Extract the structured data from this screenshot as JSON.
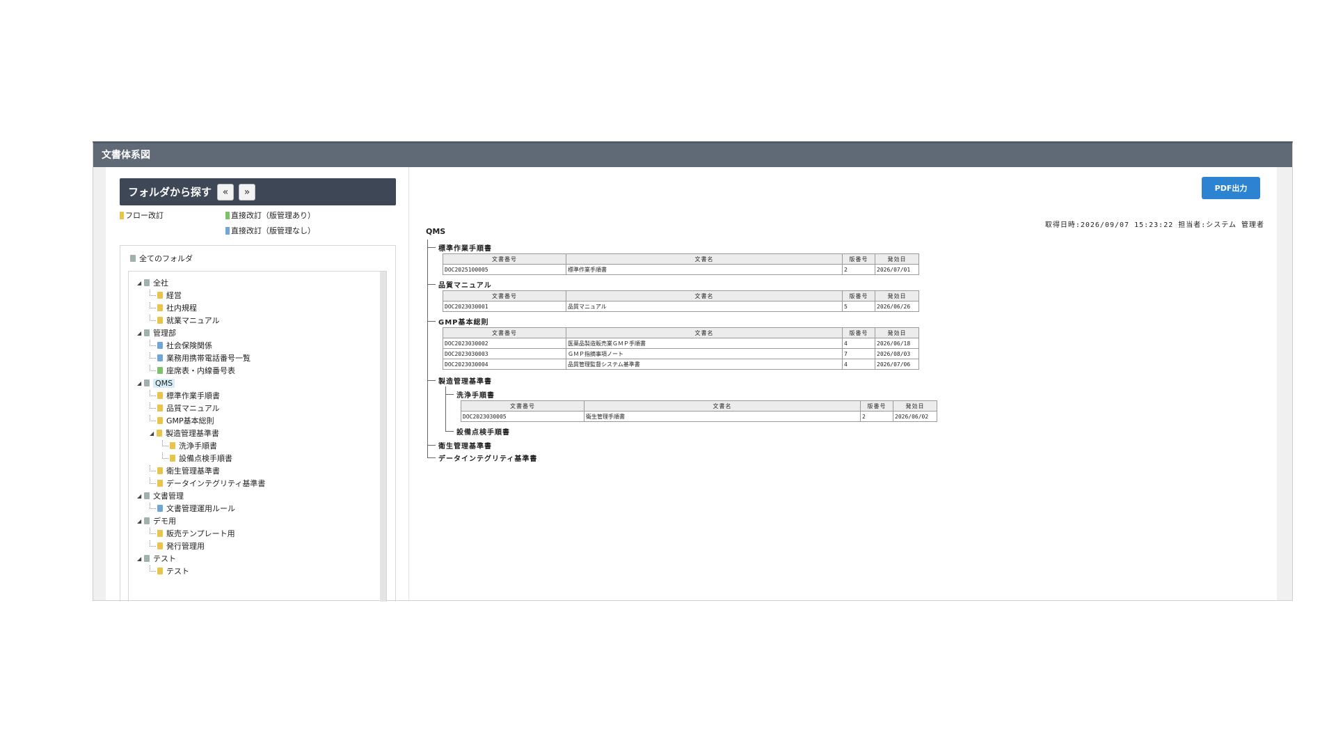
{
  "panel": {
    "title": "文書体系図"
  },
  "folder_search": {
    "title": "フォルダから探す",
    "prev_label": "«",
    "next_label": "»"
  },
  "legend": {
    "flow": "フロー改訂",
    "direct_versioned": "直接改訂（版管理あり）",
    "direct_unversioned": "直接改訂（版管理なし）"
  },
  "tree": {
    "root": "全てのフォルダ",
    "nodes": [
      {
        "label": "全社",
        "level": 0,
        "toggle": "◢",
        "icon": "gray"
      },
      {
        "label": "経営",
        "level": 1,
        "icon": "yellow"
      },
      {
        "label": "社内規程",
        "level": 1,
        "icon": "yellow"
      },
      {
        "label": "就業マニュアル",
        "level": 1,
        "icon": "yellow"
      },
      {
        "label": "管理部",
        "level": 0,
        "toggle": "◢",
        "icon": "gray"
      },
      {
        "label": "社会保険関係",
        "level": 1,
        "icon": "blue"
      },
      {
        "label": "業務用携帯電話番号一覧",
        "level": 1,
        "icon": "blue"
      },
      {
        "label": "座席表・内線番号表",
        "level": 1,
        "icon": "green"
      },
      {
        "label": "QMS",
        "level": 0,
        "toggle": "◢",
        "icon": "gray",
        "selected": true
      },
      {
        "label": "標準作業手順書",
        "level": 1,
        "icon": "yellow"
      },
      {
        "label": "品質マニュアル",
        "level": 1,
        "icon": "yellow"
      },
      {
        "label": "GMP基本総則",
        "level": 1,
        "icon": "yellow"
      },
      {
        "label": "製造管理基準書",
        "level": 1,
        "toggle": "◢",
        "icon": "yellow"
      },
      {
        "label": "洗浄手順書",
        "level": 2,
        "icon": "yellow"
      },
      {
        "label": "設備点検手順書",
        "level": 2,
        "icon": "yellow"
      },
      {
        "label": "衛生管理基準書",
        "level": 1,
        "icon": "yellow"
      },
      {
        "label": "データインテグリティ基準書",
        "level": 1,
        "icon": "yellow"
      },
      {
        "label": "文書管理",
        "level": 0,
        "toggle": "◢",
        "icon": "gray"
      },
      {
        "label": "文書管理運用ルール",
        "level": 1,
        "icon": "blue"
      },
      {
        "label": "デモ用",
        "level": 0,
        "toggle": "◢",
        "icon": "gray"
      },
      {
        "label": "販売テンプレート用",
        "level": 1,
        "icon": "yellow"
      },
      {
        "label": "発行管理用",
        "level": 1,
        "icon": "yellow"
      },
      {
        "label": "テスト",
        "level": 0,
        "toggle": "◢",
        "icon": "gray"
      },
      {
        "label": "テスト",
        "level": 1,
        "icon": "yellow"
      }
    ]
  },
  "right": {
    "pdf_button": "PDF出力",
    "meta": "取得日時:2026/09/07 15:23:22 担当者:システム 管理者",
    "root_label": "QMS",
    "columns": [
      "文書番号",
      "文書名",
      "版番号",
      "発効日"
    ],
    "sections": [
      {
        "label": "標準作業手順書",
        "rows": [
          [
            "DOC2025100005",
            "標準作業手順書",
            "2",
            "2026/07/01"
          ]
        ]
      },
      {
        "label": "品質マニュアル",
        "rows": [
          [
            "DOC2023030001",
            "品質マニュアル",
            "5",
            "2026/06/26"
          ]
        ]
      },
      {
        "label": "GMP基本総則",
        "rows": [
          [
            "DOC2023030002",
            "医薬品製造販売業ＧＭＰ手順書",
            "4",
            "2026/06/18"
          ],
          [
            "DOC2023030003",
            "ＧＭＰ指摘事項ノート",
            "7",
            "2026/08/03"
          ],
          [
            "DOC2023030004",
            "品質管理監督システム基準書",
            "4",
            "2026/07/06"
          ]
        ]
      },
      {
        "label": "製造管理基準書",
        "rows": []
      },
      {
        "label": "洗浄手順書",
        "rows": [
          [
            "DOC2023030005",
            "衛生管理手順書",
            "2",
            "2026/06/02"
          ]
        ]
      },
      {
        "label": "設備点検手順書",
        "rows": []
      },
      {
        "label": "衛生管理基準書",
        "rows": []
      },
      {
        "label": "データインテグリティ基準書",
        "rows": []
      }
    ]
  }
}
